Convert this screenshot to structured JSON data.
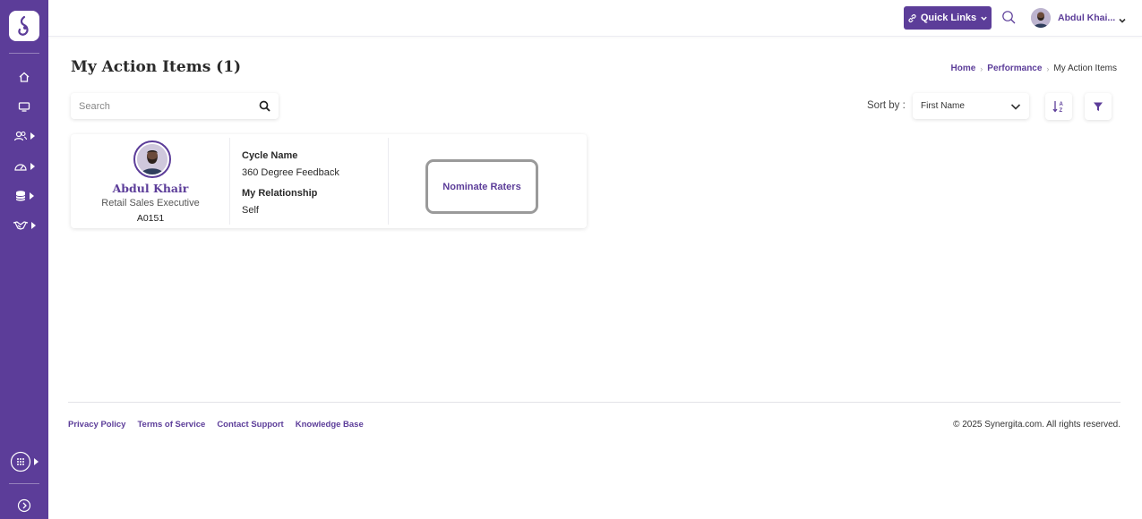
{
  "topbar": {
    "quick_links_label": "Quick Links",
    "user_name": "Abdul Khai..."
  },
  "page": {
    "title": "My Action Items (1)"
  },
  "breadcrumb": {
    "items": [
      "Home",
      "Performance",
      "My Action Items"
    ]
  },
  "search": {
    "placeholder": "Search",
    "value": ""
  },
  "sort": {
    "label": "Sort by :",
    "selected": "First Name"
  },
  "action_item": {
    "employee_name": "Abdul Khair",
    "employee_title": "Retail Sales Executive",
    "employee_id": "A0151",
    "cycle_label": "Cycle Name",
    "cycle_value": "360 Degree Feedback",
    "relationship_label": "My Relationship",
    "relationship_value": "Self",
    "action_label": "Nominate Raters"
  },
  "footer": {
    "links": [
      "Privacy Policy",
      "Terms of Service",
      "Contact Support",
      "Knowledge Base"
    ],
    "copyright": "© 2025 Synergita.com. All rights reserved."
  },
  "colors": {
    "brand": "#5c3d99",
    "highlight_border": "#9a9a9a"
  },
  "icons": {
    "sidebar": [
      "home-icon",
      "desktop-icon",
      "people-icon",
      "dashboard-gauge-icon",
      "database-icon",
      "handshake-icon",
      "apps-grid-icon",
      "expand-icon"
    ],
    "topbar": [
      "link-icon",
      "search-icon",
      "chevron-down-icon"
    ],
    "toolbar": [
      "search-icon",
      "chevron-down-icon",
      "sort-alpha-icon",
      "filter-icon"
    ]
  }
}
